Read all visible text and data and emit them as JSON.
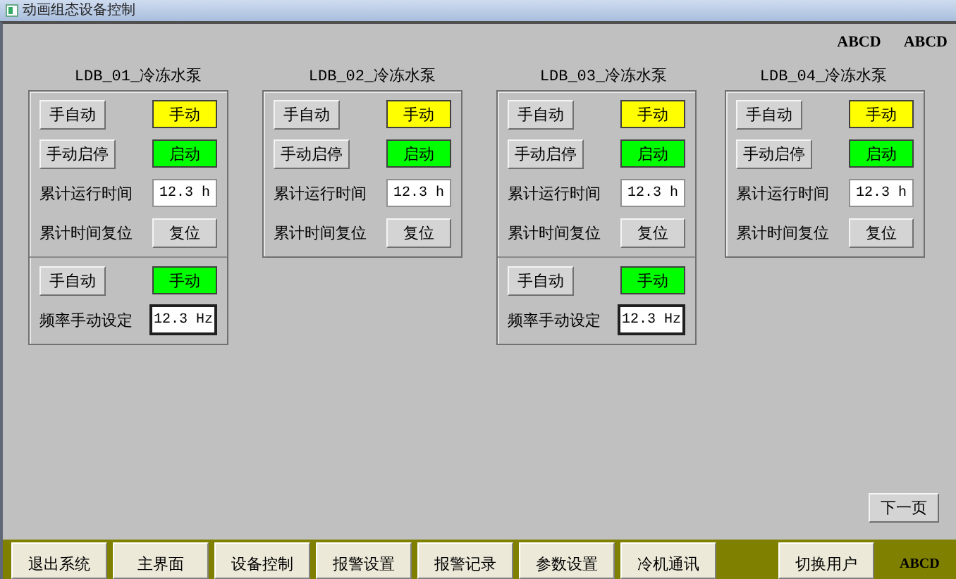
{
  "window": {
    "title": "动画组态设备控制"
  },
  "header_labels": [
    "ABCD",
    "ABCD"
  ],
  "pumps": [
    {
      "title": "LDB_01_冷冻水泵",
      "sections": [
        {
          "rows": [
            {
              "kind": "toggle",
              "label": "手自动",
              "status": "手动",
              "color": "#ffff00"
            },
            {
              "kind": "toggle",
              "label": "手动启停",
              "status": "启动",
              "color": "#00ff00"
            },
            {
              "kind": "reading",
              "label": "累计运行时间",
              "value": "12.3 h"
            },
            {
              "kind": "action",
              "label": "累计时间复位",
              "button": "复位"
            }
          ]
        },
        {
          "rows": [
            {
              "kind": "toggle",
              "label": "手自动",
              "status": "手动",
              "color": "#00ff00"
            },
            {
              "kind": "setpoint",
              "label": "频率手动设定",
              "value": "12.3 Hz"
            }
          ]
        }
      ]
    },
    {
      "title": "LDB_02_冷冻水泵",
      "sections": [
        {
          "rows": [
            {
              "kind": "toggle",
              "label": "手自动",
              "status": "手动",
              "color": "#ffff00"
            },
            {
              "kind": "toggle",
              "label": "手动启停",
              "status": "启动",
              "color": "#00ff00"
            },
            {
              "kind": "reading",
              "label": "累计运行时间",
              "value": "12.3 h"
            },
            {
              "kind": "action",
              "label": "累计时间复位",
              "button": "复位"
            }
          ]
        }
      ]
    },
    {
      "title": "LDB_03_冷冻水泵",
      "sections": [
        {
          "rows": [
            {
              "kind": "toggle",
              "label": "手自动",
              "status": "手动",
              "color": "#ffff00"
            },
            {
              "kind": "toggle",
              "label": "手动启停",
              "status": "启动",
              "color": "#00ff00"
            },
            {
              "kind": "reading",
              "label": "累计运行时间",
              "value": "12.3 h"
            },
            {
              "kind": "action",
              "label": "累计时间复位",
              "button": "复位"
            }
          ]
        },
        {
          "rows": [
            {
              "kind": "toggle",
              "label": "手自动",
              "status": "手动",
              "color": "#00ff00"
            },
            {
              "kind": "setpoint",
              "label": "频率手动设定",
              "value": "12.3 Hz"
            }
          ]
        }
      ]
    },
    {
      "title": "LDB_04_冷冻水泵",
      "sections": [
        {
          "rows": [
            {
              "kind": "toggle",
              "label": "手自动",
              "status": "手动",
              "color": "#ffff00"
            },
            {
              "kind": "toggle",
              "label": "手动启停",
              "status": "启动",
              "color": "#00ff00"
            },
            {
              "kind": "reading",
              "label": "累计运行时间",
              "value": "12.3 h"
            },
            {
              "kind": "action",
              "label": "累计时间复位",
              "button": "复位"
            }
          ]
        }
      ]
    }
  ],
  "next_button": "下一页",
  "nav": [
    {
      "kind": "button",
      "label": "退出系统"
    },
    {
      "kind": "button",
      "label": "主界面"
    },
    {
      "kind": "button",
      "label": "设备控制"
    },
    {
      "kind": "button",
      "label": "报警设置"
    },
    {
      "kind": "button",
      "label": "报警记录"
    },
    {
      "kind": "button",
      "label": "参数设置"
    },
    {
      "kind": "button",
      "label": "冷机通讯"
    },
    {
      "kind": "blank"
    },
    {
      "kind": "button",
      "label": "切换用户"
    },
    {
      "kind": "text",
      "label": "ABCD"
    }
  ]
}
